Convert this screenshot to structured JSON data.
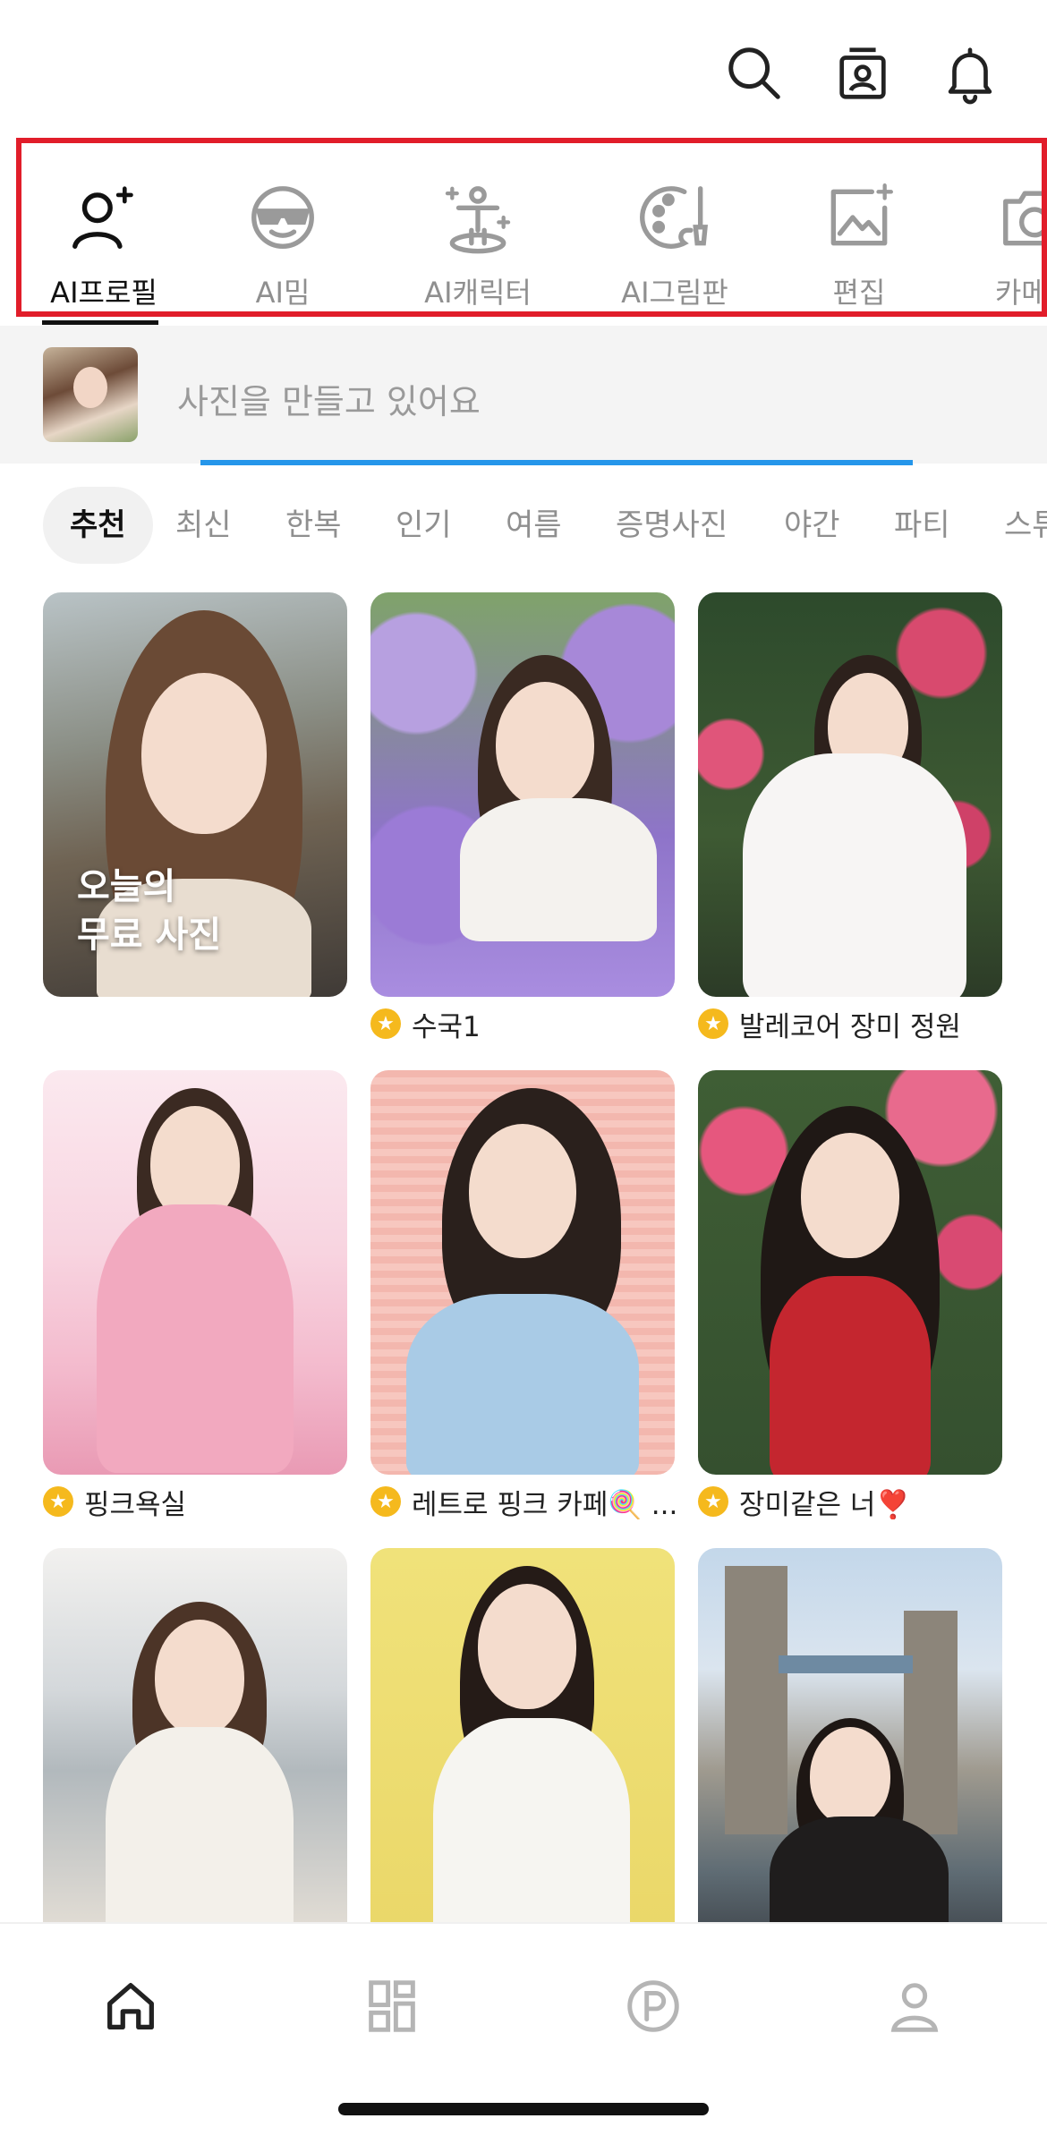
{
  "top_icons": [
    {
      "name": "search-icon"
    },
    {
      "name": "id-card-icon"
    },
    {
      "name": "bell-icon"
    }
  ],
  "categories": [
    {
      "label": "AI프로필",
      "icon": "profile-sparkle-icon",
      "active": true
    },
    {
      "label": "AI밈",
      "icon": "emoji-sunglasses-icon",
      "active": false
    },
    {
      "label": "AI캐릭터",
      "icon": "character-sparkle-icon",
      "active": false
    },
    {
      "label": "AI그림판",
      "icon": "palette-brush-icon",
      "active": false
    },
    {
      "label": "편집",
      "icon": "image-edit-icon",
      "active": false
    },
    {
      "label": "카메라",
      "icon": "camera-icon",
      "active": false
    }
  ],
  "progress": {
    "text": "사진을 만들고 있어요",
    "value": 0.68
  },
  "chips": [
    "추천",
    "최신",
    "한복",
    "인기",
    "여름",
    "증명사진",
    "야간",
    "파티",
    "스튜"
  ],
  "cards": [
    {
      "caption": "",
      "overlay": [
        "오늘의",
        "무료 사진"
      ],
      "star": false
    },
    {
      "caption": "수국1",
      "star": true
    },
    {
      "caption": "발레코어 장미 정원",
      "star": true
    },
    {
      "caption": "핑크욕실",
      "star": true
    },
    {
      "caption": "레트로 핑크 카페🍭 ...",
      "star": true
    },
    {
      "caption": "장미같은 너❣️",
      "star": true
    },
    {
      "caption": "",
      "star": false
    },
    {
      "caption": "",
      "star": false
    },
    {
      "caption": "",
      "star": false
    }
  ],
  "bottom_nav": [
    {
      "name": "home-icon",
      "active": true
    },
    {
      "name": "grid-icon",
      "active": false
    },
    {
      "name": "points-icon",
      "active": false
    },
    {
      "name": "profile-icon",
      "active": false
    }
  ],
  "colors": {
    "accent": "#2596EA",
    "highlight_box": "#E11D2A",
    "star": "#F5B91D"
  }
}
